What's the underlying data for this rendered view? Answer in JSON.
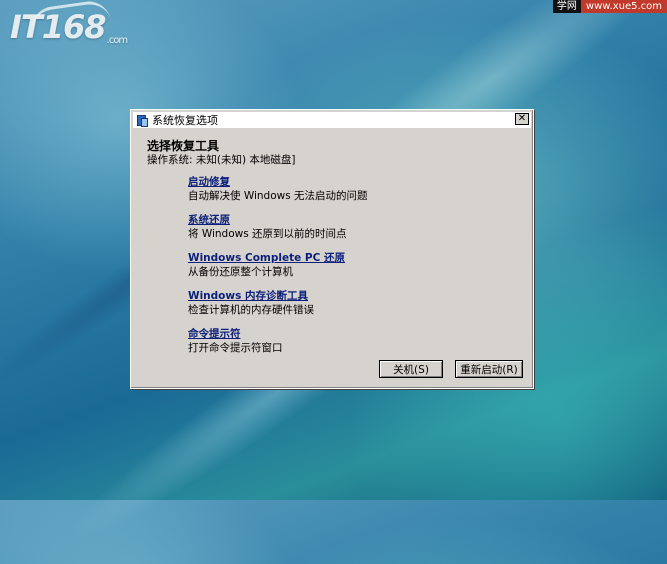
{
  "desktop": {
    "logo_text": "IT168",
    "logo_suffix": ".com",
    "watermark_label": "学网",
    "watermark_url": "www.xue5.com"
  },
  "dialog": {
    "title": "系统恢复选项",
    "close_glyph": "✕",
    "heading": "选择恢复工具",
    "os_line": "操作系统: 未知(未知) 本地磁盘]",
    "tools": [
      {
        "label": "启动修复",
        "description": "自动解决使 Windows 无法启动的问题"
      },
      {
        "label": "系统还原",
        "description": "将 Windows 还原到以前的时间点"
      },
      {
        "label": "Windows Complete PC 还原",
        "description": "从备份还原整个计算机"
      },
      {
        "label": "Windows 内存诊断工具",
        "description": "检查计算机的内存硬件错误"
      },
      {
        "label": "命令提示符",
        "description": "打开命令提示符窗口"
      }
    ],
    "buttons": {
      "shutdown": "关机(S)",
      "restart": "重新启动(R)"
    }
  },
  "colors": {
    "link": "#0a1f7a",
    "dialog_bg": "#d6d3ce"
  }
}
